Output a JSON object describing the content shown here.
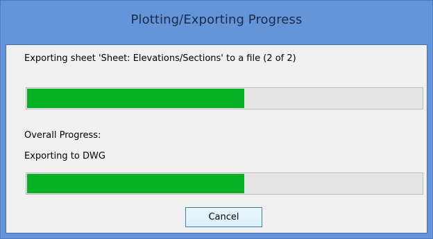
{
  "window": {
    "title": "Plotting/Exporting Progress"
  },
  "sheet_progress": {
    "label": "Exporting sheet 'Sheet: Elevations/Sections' to a file (2 of 2)",
    "percent": 55
  },
  "overall_progress": {
    "label": "Overall Progress:",
    "status": "Exporting to DWG",
    "percent": 55
  },
  "buttons": {
    "cancel_label": "Cancel"
  },
  "colors": {
    "title_bar": "#6495d8",
    "progress_fill": "#06b025",
    "progress_track": "#e6e6e6"
  }
}
